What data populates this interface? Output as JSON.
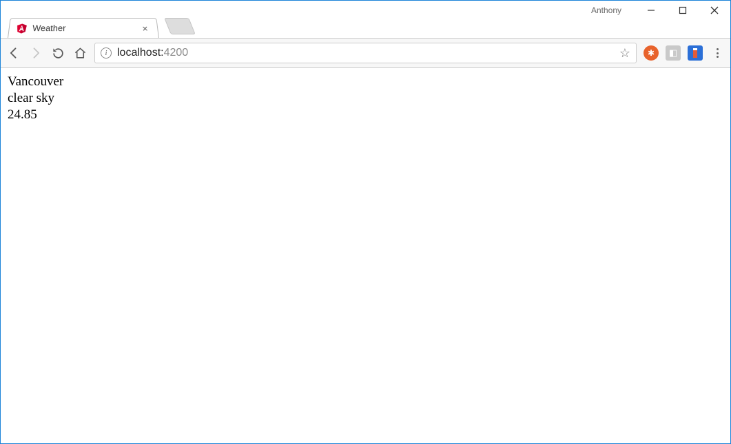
{
  "window": {
    "profile_name": "Anthony"
  },
  "tab": {
    "title": "Weather",
    "favicon": "angular-shield"
  },
  "address": {
    "host": "localhost:",
    "port": "4200"
  },
  "page": {
    "city": "Vancouver",
    "description": "clear sky",
    "temperature": "24.85"
  }
}
